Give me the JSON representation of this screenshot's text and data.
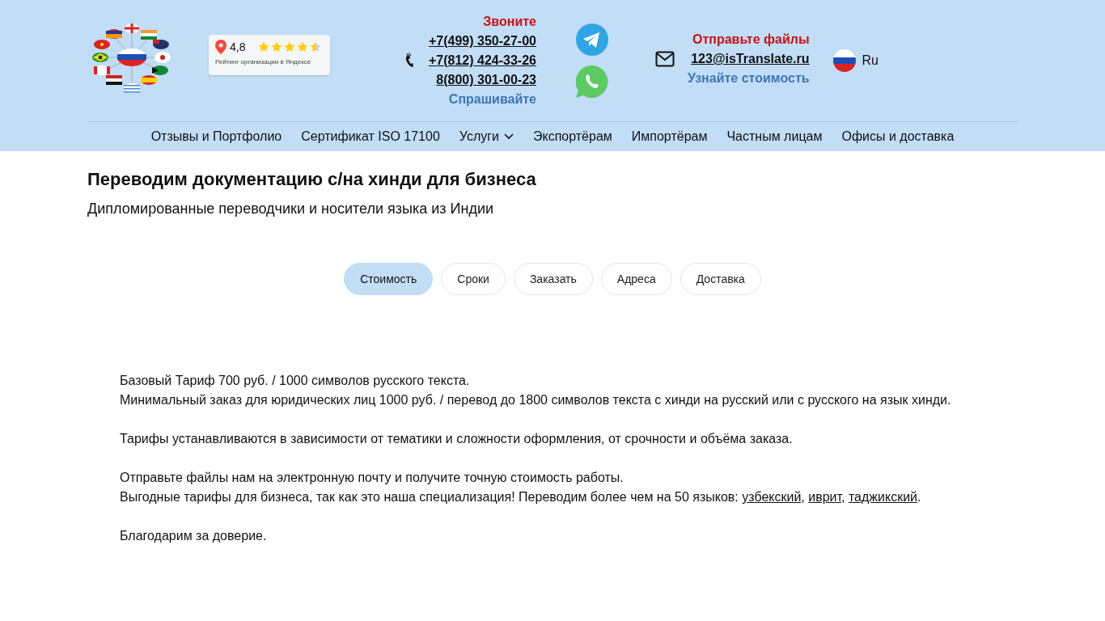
{
  "rating": {
    "value": "4,8",
    "stars": 4.5,
    "caption": "Рейтинг организации в Яндексе"
  },
  "contacts": {
    "call_label": "Звоните",
    "phones": [
      "+7(499) 350-27-00",
      "+7(812) 424-33-26",
      "8(800) 301-00-23"
    ],
    "ask_label": "Спрашивайте"
  },
  "mail": {
    "send_label": "Отправьте файлы",
    "email": "123@isTranslate.ru",
    "price_label": "Узнайте стоимость"
  },
  "language": {
    "label": "Ru"
  },
  "nav": [
    {
      "label": "Отзывы и Портфолио",
      "kind": "link"
    },
    {
      "label": "Сертификат ISO 17100",
      "kind": "link"
    },
    {
      "label": "Услуги",
      "kind": "dropdown"
    },
    {
      "label": "Экспортёрам",
      "kind": "link"
    },
    {
      "label": "Импортёрам",
      "kind": "link"
    },
    {
      "label": "Частным лицам",
      "kind": "link"
    },
    {
      "label": "Офисы и доставка",
      "kind": "link"
    }
  ],
  "title": "Переводим документацию с/на хинди для бизнеса",
  "subtitle": "Дипломированные переводчики и носители языка из Индии",
  "tabs": [
    {
      "label": "Стоимость",
      "selected": true
    },
    {
      "label": "Сроки",
      "selected": false
    },
    {
      "label": "Заказать",
      "selected": false
    },
    {
      "label": "Адреса",
      "selected": false
    },
    {
      "label": "Доставка",
      "selected": false
    }
  ],
  "paragraphs": [
    [
      [
        {
          "kind": "text",
          "text": "Базовый Тариф 700 руб. / 1000 символов русского текста."
        }
      ],
      [
        {
          "kind": "text",
          "text": "Минимальный заказ для юридических лиц 1000 руб. / перевод до 1800 символов текста с хинди на русский или с русского на язык хинди."
        }
      ]
    ],
    [
      [
        {
          "kind": "text",
          "text": "Тарифы устанавливаются в зависимости от тематики и сложности оформления, от срочности и объёма заказа."
        }
      ]
    ],
    [
      [
        {
          "kind": "text",
          "text": "Отправьте файлы нам на электронную почту и получите точную стоимость работы."
        }
      ],
      [
        {
          "kind": "text",
          "text": "Выгодные тарифы для бизнеса, так как это наша специализация! Переводим более чем на 50 языков: "
        },
        {
          "kind": "link",
          "text": "узбекский"
        },
        {
          "kind": "text",
          "text": ", "
        },
        {
          "kind": "link",
          "text": "иврит"
        },
        {
          "kind": "text",
          "text": ", "
        },
        {
          "kind": "link",
          "text": "таджикский"
        },
        {
          "kind": "text",
          "text": "."
        }
      ]
    ],
    [
      [
        {
          "kind": "text",
          "text": "Благодарим за доверие."
        }
      ]
    ]
  ]
}
